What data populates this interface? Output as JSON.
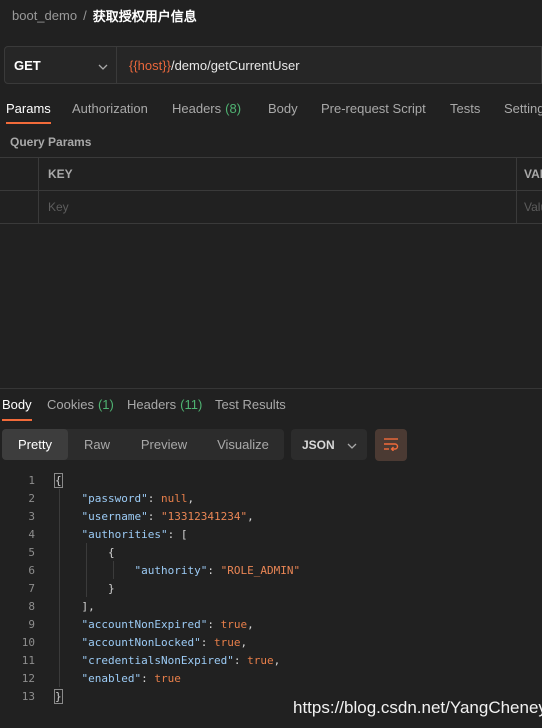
{
  "breadcrumb": {
    "collection": "boot_demo",
    "separator": "/",
    "request_name": "获取授权用户信息"
  },
  "request": {
    "method": "GET",
    "url_variable": "{{host}}",
    "url_path": "/demo/getCurrentUser"
  },
  "request_tabs": [
    {
      "label": "Params",
      "count": "",
      "active": true
    },
    {
      "label": "Authorization",
      "count": "",
      "active": false
    },
    {
      "label": "Headers",
      "count": "(8)",
      "active": false
    },
    {
      "label": "Body",
      "count": "",
      "active": false
    },
    {
      "label": "Pre-request Script",
      "count": "",
      "active": false
    },
    {
      "label": "Tests",
      "count": "",
      "active": false
    },
    {
      "label": "Settings",
      "count": "",
      "active": false
    }
  ],
  "query_params": {
    "label": "Query Params",
    "col_key": "KEY",
    "col_value": "VALUE",
    "key_placeholder": "Key",
    "value_placeholder": "Value"
  },
  "response_tabs": [
    {
      "label": "Body",
      "count": "",
      "active": true
    },
    {
      "label": "Cookies",
      "count": "(1)",
      "active": false
    },
    {
      "label": "Headers",
      "count": "(11)",
      "active": false
    },
    {
      "label": "Test Results",
      "count": "",
      "active": false
    }
  ],
  "view_modes": [
    "Pretty",
    "Raw",
    "Preview",
    "Visualize"
  ],
  "active_view": "Pretty",
  "format": "JSON",
  "icons": {
    "method_dropdown": "chevron-down-icon",
    "format_dropdown": "chevron-down-icon",
    "wrap": "wrap-lines-icon"
  },
  "colors": {
    "accent": "#f26b3a",
    "count": "#4fb372",
    "key": "#9ccbf5",
    "string": "#ea8655"
  },
  "code_lines": [
    {
      "n": "1",
      "text": "{"
    },
    {
      "n": "2",
      "text": "    \"password\": null,"
    },
    {
      "n": "3",
      "text": "    \"username\": \"13312341234\","
    },
    {
      "n": "4",
      "text": "    \"authorities\": ["
    },
    {
      "n": "5",
      "text": "        {"
    },
    {
      "n": "6",
      "text": "            \"authority\": \"ROLE_ADMIN\""
    },
    {
      "n": "7",
      "text": "        }"
    },
    {
      "n": "8",
      "text": "    ],"
    },
    {
      "n": "9",
      "text": "    \"accountNonExpired\": true,"
    },
    {
      "n": "10",
      "text": "    \"accountNonLocked\": true,"
    },
    {
      "n": "11",
      "text": "    \"credentialsNonExpired\": true,"
    },
    {
      "n": "12",
      "text": "    \"enabled\": true"
    },
    {
      "n": "13",
      "text": "}"
    }
  ],
  "watermark": "https://blog.csdn.net/YangCheney"
}
